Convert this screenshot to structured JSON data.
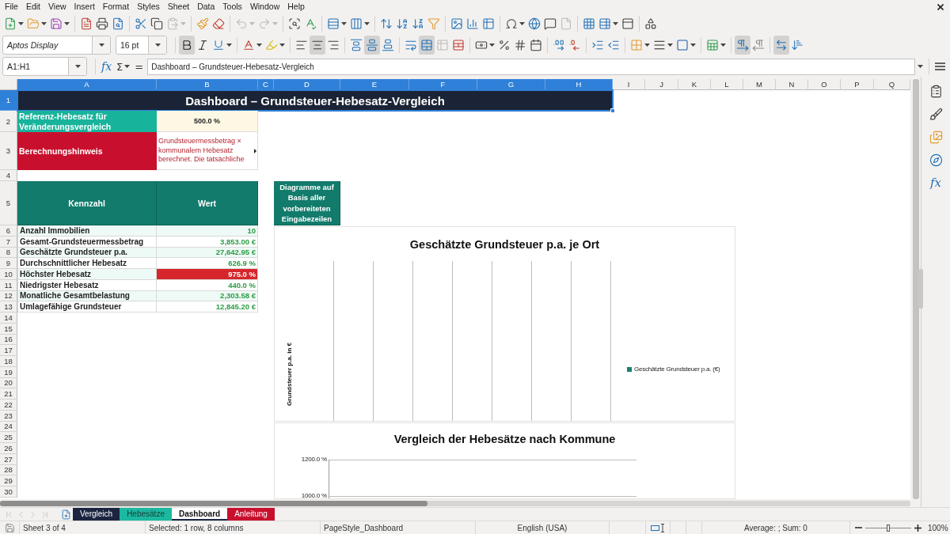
{
  "menu_bar": {
    "items": [
      "File",
      "Edit",
      "View",
      "Insert",
      "Format",
      "Styles",
      "Sheet",
      "Data",
      "Tools",
      "Window",
      "Help"
    ]
  },
  "standard_toolbar": [
    [
      {
        "kind": "new",
        "dropdown": true,
        "disabled": false
      },
      {
        "kind": "open",
        "dropdown": true,
        "disabled": false
      },
      {
        "kind": "save",
        "dropdown": true,
        "disabled": false
      }
    ],
    [
      {
        "kind": "pdf",
        "dropdown": false,
        "disabled": false
      },
      {
        "kind": "print",
        "dropdown": false,
        "disabled": false
      },
      {
        "kind": "preview",
        "dropdown": false,
        "disabled": false
      }
    ],
    [
      {
        "kind": "cut",
        "dropdown": false,
        "disabled": false
      },
      {
        "kind": "copy",
        "dropdown": false,
        "disabled": false
      },
      {
        "kind": "paste",
        "dropdown": true,
        "disabled": true
      }
    ],
    [
      {
        "kind": "clone",
        "dropdown": false,
        "disabled": false
      },
      {
        "kind": "clear",
        "dropdown": false,
        "disabled": false
      }
    ],
    [
      {
        "kind": "undo",
        "dropdown": true,
        "disabled": true
      },
      {
        "kind": "redo",
        "dropdown": true,
        "disabled": true
      }
    ],
    [
      {
        "kind": "find",
        "dropdown": false,
        "disabled": false
      },
      {
        "kind": "spelling",
        "dropdown": false,
        "disabled": false
      }
    ],
    [
      {
        "kind": "rows",
        "dropdown": true,
        "disabled": false
      },
      {
        "kind": "columns",
        "dropdown": true,
        "disabled": false
      }
    ],
    [
      {
        "kind": "sort",
        "dropdown": false,
        "disabled": false
      },
      {
        "kind": "ascending",
        "dropdown": false,
        "disabled": false
      },
      {
        "kind": "descending",
        "dropdown": false,
        "disabled": false
      },
      {
        "kind": "filter",
        "dropdown": false,
        "disabled": false
      }
    ],
    [
      {
        "kind": "image",
        "dropdown": false,
        "disabled": false
      },
      {
        "kind": "chart",
        "dropdown": false,
        "disabled": false
      },
      {
        "kind": "pivot",
        "dropdown": false,
        "disabled": false
      }
    ],
    [
      {
        "kind": "special",
        "dropdown": true,
        "disabled": false
      },
      {
        "kind": "hyperlink",
        "dropdown": false,
        "disabled": false
      },
      {
        "kind": "comment",
        "dropdown": false,
        "disabled": false
      },
      {
        "kind": "header",
        "dropdown": false,
        "disabled": true
      }
    ],
    [
      {
        "kind": "printarea",
        "dropdown": false,
        "disabled": false
      },
      {
        "kind": "freeze",
        "dropdown": true,
        "disabled": false
      },
      {
        "kind": "split",
        "dropdown": false,
        "disabled": false
      }
    ],
    [
      {
        "kind": "draw",
        "dropdown": false,
        "disabled": false
      }
    ]
  ],
  "formatting_toolbar": {
    "font_name": "Aptos Display",
    "font_size": "16 pt",
    "groups": [
      [
        {
          "kind": "bold",
          "dropdown": false,
          "active": true,
          "disabled": false
        },
        {
          "kind": "italic",
          "dropdown": false,
          "active": false,
          "disabled": false
        },
        {
          "kind": "underline",
          "dropdown": true,
          "active": false,
          "disabled": false
        }
      ],
      [
        {
          "kind": "fontcolor",
          "dropdown": true,
          "active": false,
          "disabled": false
        },
        {
          "kind": "highlight",
          "dropdown": true,
          "active": false,
          "disabled": false
        }
      ],
      [
        {
          "kind": "left",
          "dropdown": false,
          "active": false,
          "disabled": false
        },
        {
          "kind": "center",
          "dropdown": false,
          "active": true,
          "disabled": false
        },
        {
          "kind": "right",
          "dropdown": false,
          "active": false,
          "disabled": false
        }
      ],
      [
        {
          "kind": "top",
          "dropdown": false,
          "active": false,
          "disabled": false
        },
        {
          "kind": "middle",
          "dropdown": false,
          "active": true,
          "disabled": false
        },
        {
          "kind": "bottom",
          "dropdown": false,
          "active": false,
          "disabled": false
        }
      ],
      [
        {
          "kind": "wrap",
          "dropdown": false,
          "active": false,
          "disabled": false
        },
        {
          "kind": "mergecenter",
          "dropdown": false,
          "active": true,
          "disabled": false
        },
        {
          "kind": "merge",
          "dropdown": false,
          "active": false,
          "disabled": true
        },
        {
          "kind": "unmerge",
          "dropdown": false,
          "active": false,
          "disabled": false
        }
      ],
      [
        {
          "kind": "currency",
          "dropdown": true,
          "active": false,
          "disabled": false
        },
        {
          "kind": "percent",
          "dropdown": false,
          "active": false,
          "disabled": false
        },
        {
          "kind": "number",
          "dropdown": false,
          "active": false,
          "disabled": false
        },
        {
          "kind": "date",
          "dropdown": false,
          "active": false,
          "disabled": false
        }
      ],
      [
        {
          "kind": "adddecimal",
          "dropdown": false,
          "active": false,
          "disabled": false
        },
        {
          "kind": "deldecimal",
          "dropdown": false,
          "active": false,
          "disabled": false
        }
      ],
      [
        {
          "kind": "indent",
          "dropdown": false,
          "active": false,
          "disabled": false
        },
        {
          "kind": "outdent",
          "dropdown": false,
          "active": false,
          "disabled": false
        }
      ],
      [
        {
          "kind": "borders",
          "dropdown": true,
          "active": false,
          "disabled": false
        },
        {
          "kind": "borderstyle",
          "dropdown": true,
          "active": false,
          "disabled": false
        },
        {
          "kind": "bordercolor",
          "dropdown": true,
          "active": false,
          "disabled": false
        }
      ],
      [
        {
          "kind": "conditional",
          "dropdown": true,
          "active": false,
          "disabled": false
        }
      ],
      [
        {
          "kind": "ltr",
          "dropdown": false,
          "active": true,
          "disabled": false
        },
        {
          "kind": "rtl",
          "dropdown": false,
          "active": false,
          "disabled": false
        }
      ],
      [
        {
          "kind": "orientation",
          "dropdown": false,
          "active": true,
          "disabled": false
        },
        {
          "kind": "vertical",
          "dropdown": false,
          "active": false,
          "disabled": false
        }
      ]
    ]
  },
  "formula_bar": {
    "name_box": "A1:H1",
    "wizard": "fx",
    "sum": "Σ",
    "equals": "=",
    "content": "Dashboard – Grundsteuer-Hebesatz-Vergleich"
  },
  "sidebar": {
    "functions": "fx"
  },
  "sheet": {
    "columns": [
      {
        "label": "A",
        "selected": true
      },
      {
        "label": "B",
        "selected": true
      },
      {
        "label": "C",
        "selected": true
      },
      {
        "label": "D",
        "selected": true
      },
      {
        "label": "E",
        "selected": true
      },
      {
        "label": "F",
        "selected": true
      },
      {
        "label": "G",
        "selected": true
      },
      {
        "label": "H",
        "selected": true
      },
      {
        "label": "I",
        "selected": false
      },
      {
        "label": "J",
        "selected": false
      },
      {
        "label": "K",
        "selected": false
      },
      {
        "label": "L",
        "selected": false
      },
      {
        "label": "M",
        "selected": false
      },
      {
        "label": "N",
        "selected": false
      },
      {
        "label": "O",
        "selected": false
      },
      {
        "label": "P",
        "selected": false
      },
      {
        "label": "Q",
        "selected": false
      }
    ],
    "rows": [
      {
        "label": "1",
        "selected": true
      },
      {
        "label": "2",
        "selected": false
      },
      {
        "label": "3",
        "selected": false
      },
      {
        "label": "4",
        "selected": false
      },
      {
        "label": "5",
        "selected": false
      },
      {
        "label": "6",
        "selected": false
      },
      {
        "label": "7",
        "selected": false
      },
      {
        "label": "8",
        "selected": false
      },
      {
        "label": "9",
        "selected": false
      },
      {
        "label": "10",
        "selected": false
      },
      {
        "label": "11",
        "selected": false
      },
      {
        "label": "12",
        "selected": false
      },
      {
        "label": "13",
        "selected": false
      },
      {
        "label": "14",
        "selected": false
      },
      {
        "label": "15",
        "selected": false
      },
      {
        "label": "16",
        "selected": false
      },
      {
        "label": "17",
        "selected": false
      },
      {
        "label": "18",
        "selected": false
      },
      {
        "label": "19",
        "selected": false
      },
      {
        "label": "20",
        "selected": false
      },
      {
        "label": "21",
        "selected": false
      },
      {
        "label": "22",
        "selected": false
      },
      {
        "label": "23",
        "selected": false
      },
      {
        "label": "24",
        "selected": false
      },
      {
        "label": "25",
        "selected": false
      },
      {
        "label": "26",
        "selected": false
      },
      {
        "label": "27",
        "selected": false
      },
      {
        "label": "28",
        "selected": false
      },
      {
        "label": "29",
        "selected": false
      },
      {
        "label": "30",
        "selected": false
      }
    ],
    "title": {
      "text": "Dashboard – Grundsteuer-Hebesatz-Vergleich",
      "selected": true
    },
    "reference": {
      "label": "Referenz-Hebesatz für Veränderungsvergleich",
      "value": "500.0 %"
    },
    "note": {
      "label": "Berechnungshinweis",
      "text": "Grundsteuermessbetrag × kommunalem Hebesatz berechnet. Die tatsächliche",
      "overflow": true
    },
    "kpi": {
      "columns": [
        "Kennzahl",
        "Wert"
      ],
      "rows": [
        {
          "label": "Anzahl Immobilien",
          "value": "10",
          "highlight": false
        },
        {
          "label": "Gesamt-Grundsteuermessbetrag",
          "value": "3,853.00 €",
          "highlight": false
        },
        {
          "label": "Geschätzte Grundsteuer p.a.",
          "value": "27,642.95 €",
          "highlight": false
        },
        {
          "label": "Durchschnittlicher Hebesatz",
          "value": "626.9 %",
          "highlight": false
        },
        {
          "label": "Höchster Hebesatz",
          "value": "975.0 %",
          "highlight": true
        },
        {
          "label": "Niedrigster Hebesatz",
          "value": "440.0 %",
          "highlight": false
        },
        {
          "label": "Monatliche Gesamtbelastung",
          "value": "2,303.58 €",
          "highlight": false
        },
        {
          "label": "Umlagefähige Grundsteuer",
          "value": "12,845.20 €",
          "highlight": false
        }
      ]
    },
    "chart_hint": "Diagramme auf Basis aller vorbereiteten Eingabezeilen"
  },
  "charts": [
    {
      "title": "Geschätzte Grundsteuer p.a. je Ort",
      "ylabel": "Grundsteuer p.a. in €",
      "legend": [
        {
          "label": "Geschätzte Grundsteuer p.a. (€)",
          "color": "#1a7f72"
        }
      ]
    },
    {
      "title": "Vergleich der Hebesätze nach Kommune",
      "ytick_labels": [
        "1200.0 %",
        "1000.0 %"
      ]
    }
  ],
  "sheet_bar": {
    "navigation": [
      {
        "disabled": true
      },
      {
        "disabled": true
      },
      {
        "disabled": true
      },
      {
        "disabled": true
      }
    ],
    "tabs": [
      {
        "label": "Vergleich",
        "color": "#1c2540",
        "selected": false
      },
      {
        "label": "Hebesätze",
        "color": "#1cb89f",
        "selected": false
      },
      {
        "label": "Dashboard",
        "color": "#1c2540",
        "selected": true
      },
      {
        "label": "Anleitung",
        "color": "#c8102e",
        "selected": false
      }
    ]
  },
  "status_bar": {
    "sheet": "Sheet 3 of 4",
    "selection": "Selected: 1 row, 8 columns",
    "page_style": "PageStyle_Dashboard",
    "language": "English (USA)",
    "summary": "Average: ; Sum: 0",
    "zoom_slider": {
      "level": 0.5
    },
    "zoom": "100%"
  }
}
